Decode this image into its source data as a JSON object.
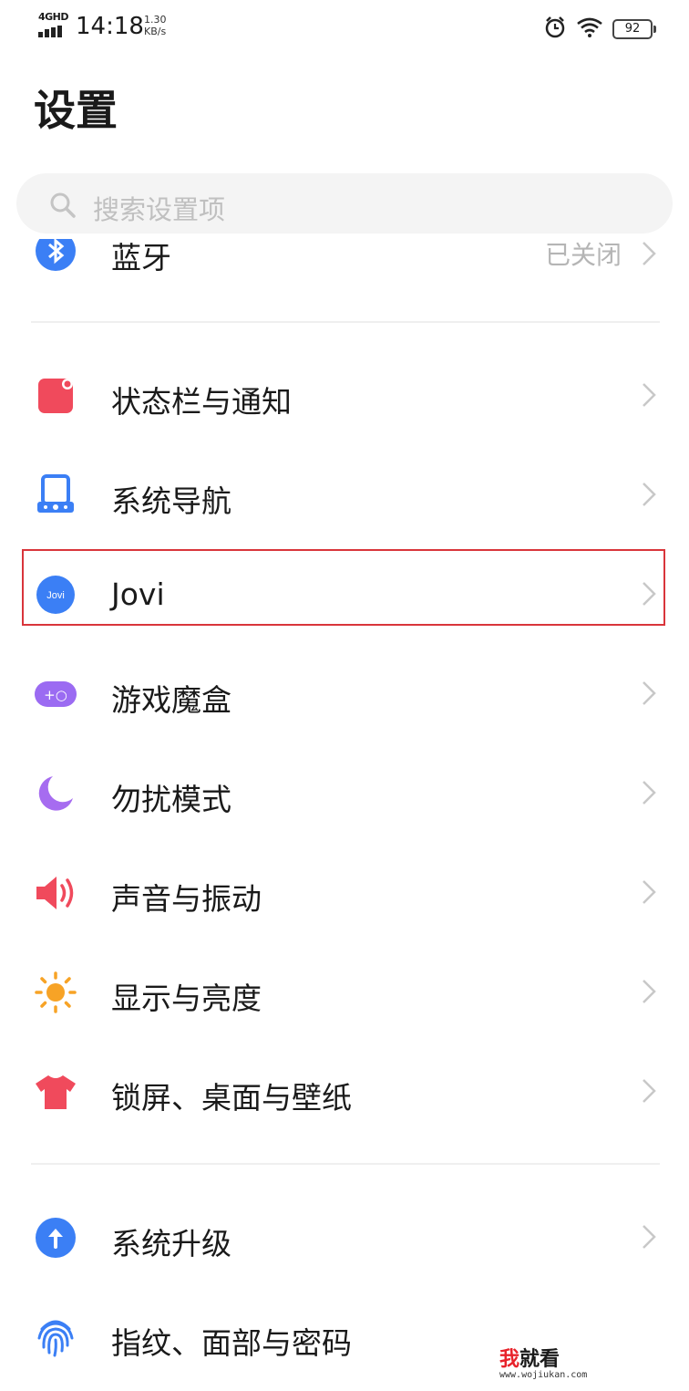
{
  "status_bar": {
    "network": "4GHD",
    "time": "14:18",
    "speed_value": "1.30",
    "speed_unit": "KB/s",
    "battery": "92",
    "icons": [
      "alarm-icon",
      "wifi-icon",
      "battery-icon"
    ]
  },
  "header": {
    "title": "设置"
  },
  "search": {
    "placeholder": "搜索设置项"
  },
  "menu": [
    {
      "label": "蓝牙",
      "value": "已关闭",
      "icon": "bluetooth-icon"
    },
    {
      "label": "状态栏与通知",
      "icon": "status-bar-icon"
    },
    {
      "label": "系统导航",
      "icon": "navigation-icon"
    },
    {
      "label": "Jovi",
      "icon": "jovi-icon",
      "highlighted": true
    },
    {
      "label": "游戏魔盒",
      "icon": "game-box-icon"
    },
    {
      "label": "勿扰模式",
      "icon": "moon-icon"
    },
    {
      "label": "声音与振动",
      "icon": "speaker-icon"
    },
    {
      "label": "显示与亮度",
      "icon": "sun-icon"
    },
    {
      "label": "锁屏、桌面与壁纸",
      "icon": "tshirt-icon"
    },
    {
      "label": "系统升级",
      "icon": "upgrade-icon"
    },
    {
      "label": "指纹、面部与密码",
      "icon": "fingerprint-icon"
    }
  ],
  "icon_glyphs": {
    "jovi": "Jovi",
    "game": "+○"
  },
  "watermark": {
    "main_red": "我",
    "main_dark": "就看",
    "sub": "www.wojiukan.com"
  },
  "colors": {
    "highlight": "#d9353b",
    "blue": "#3b7ff5",
    "red": "#f04a5c",
    "purple": "#9b6bf2",
    "orange": "#f7a326"
  }
}
